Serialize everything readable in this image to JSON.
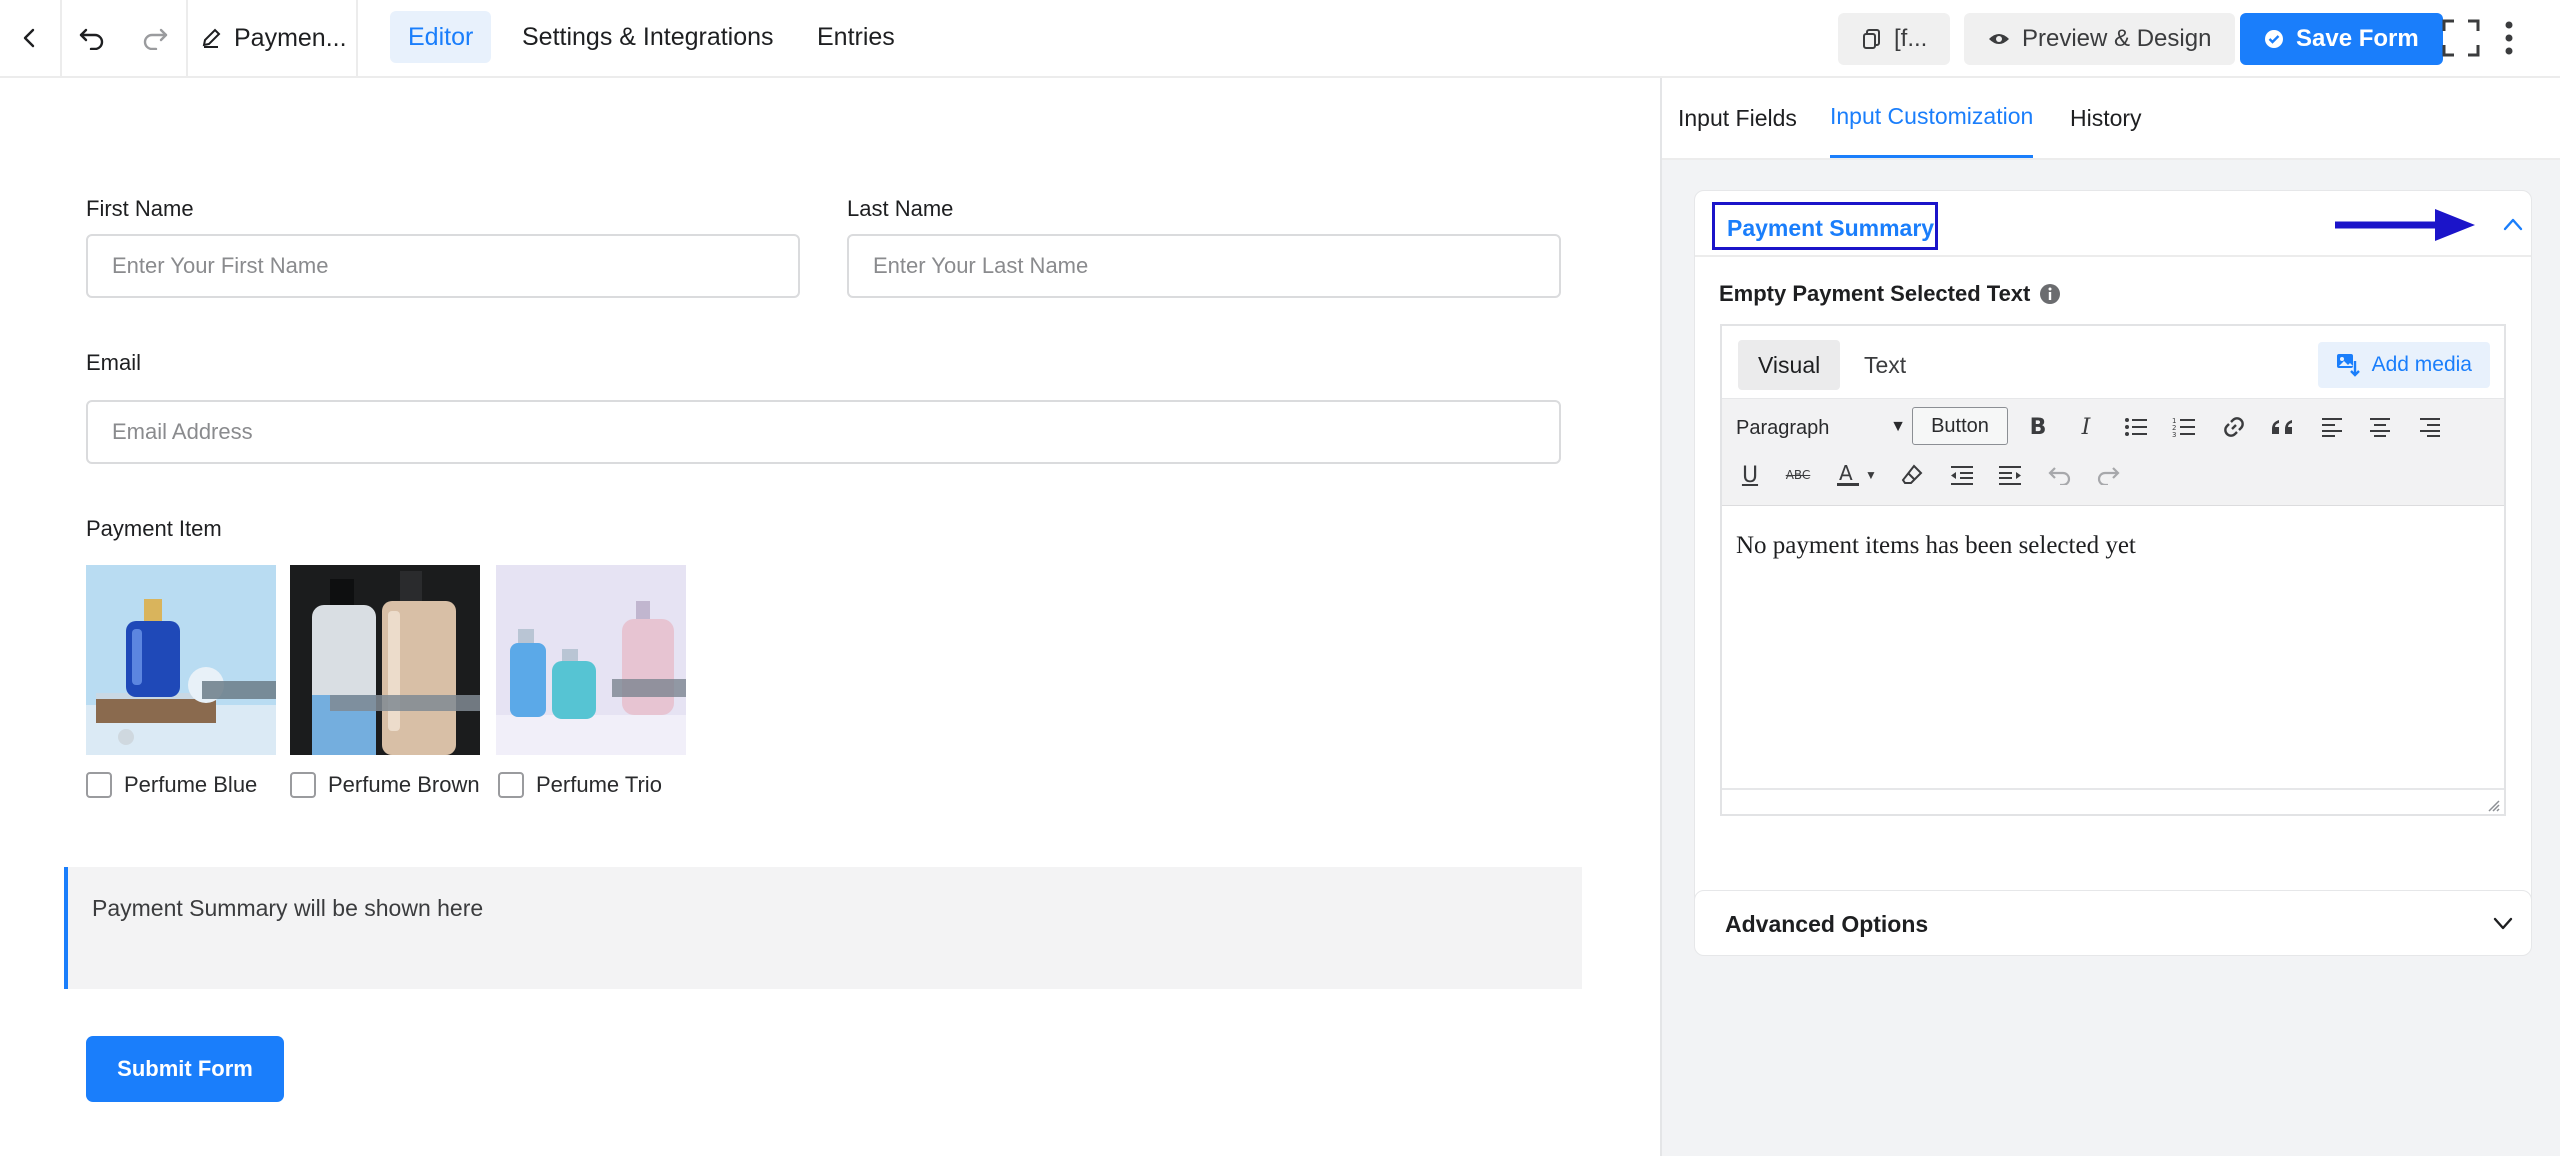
{
  "topbar": {
    "back_icon": "chevron-left-icon",
    "undo_icon": "undo-icon",
    "redo_icon": "redo-icon",
    "form_title": "Paymen...",
    "form_title_icon": "pencil-icon",
    "tabs": [
      {
        "label": "Editor",
        "active": true
      },
      {
        "label": "Settings & Integrations",
        "active": false
      },
      {
        "label": "Entries",
        "active": false
      }
    ],
    "shortcode_label": "[f...",
    "shortcode_icon": "copy-icon",
    "preview_label": "Preview & Design",
    "preview_icon": "eye-icon",
    "save_label": "Save Form",
    "save_icon": "check-circle-icon",
    "fullscreen_icon": "fullscreen-icon",
    "more_icon": "more-vertical-icon"
  },
  "form": {
    "first_name": {
      "label": "First Name",
      "placeholder": "Enter Your First Name"
    },
    "last_name": {
      "label": "Last Name",
      "placeholder": "Enter Your Last Name"
    },
    "email": {
      "label": "Email",
      "placeholder": "Email Address"
    },
    "payment_item": {
      "label": "Payment Item",
      "items": [
        {
          "label": "Perfume Blue",
          "checked": false
        },
        {
          "label": "Perfume Brown",
          "checked": false
        },
        {
          "label": "Perfume Trio",
          "checked": false
        }
      ]
    },
    "summary_placeholder": "Payment Summary will be shown here",
    "submit_label": "Submit Form"
  },
  "panel": {
    "tabs": [
      {
        "label": "Input Fields",
        "active": false
      },
      {
        "label": "Input Customization",
        "active": true
      },
      {
        "label": "History",
        "active": false
      }
    ],
    "section_title": "Payment Summary",
    "collapse_icon": "chevron-up-icon",
    "field_label": "Empty Payment Selected Text",
    "info_icon": "info-icon",
    "editor": {
      "tabs": [
        {
          "label": "Visual",
          "active": true
        },
        {
          "label": "Text",
          "active": false
        }
      ],
      "add_media_label": "Add media",
      "format_select": "Paragraph",
      "button_tool": "Button",
      "content": "No payment items has been selected yet"
    },
    "advanced_label": "Advanced Options",
    "advanced_icon": "chevron-down-icon"
  },
  "colors": {
    "accent": "#1a7efb",
    "annotation": "#1b14c9",
    "panel_bg": "#f2f3f5"
  }
}
